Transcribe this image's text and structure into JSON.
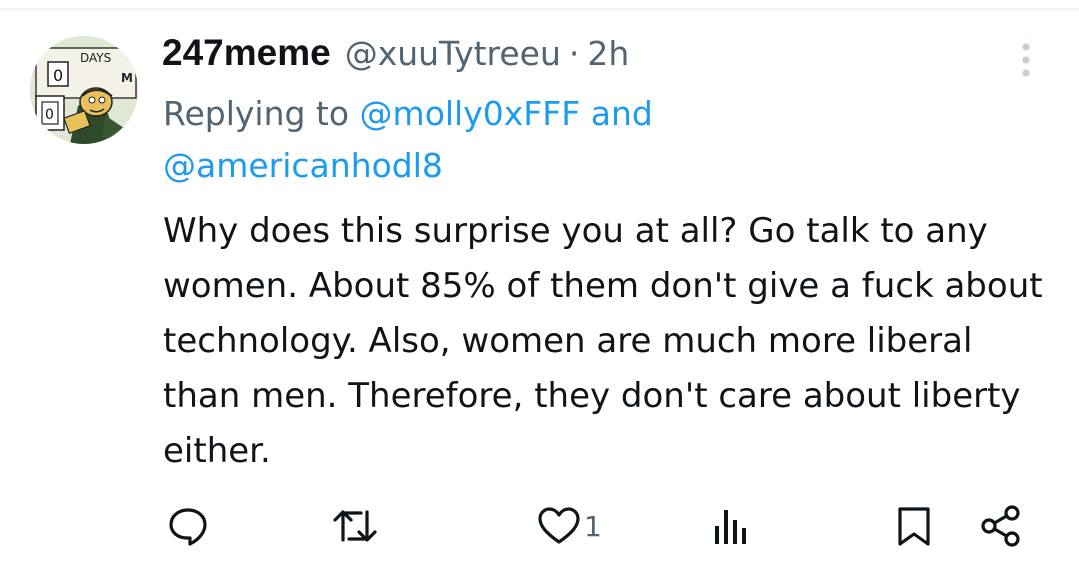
{
  "tweet": {
    "display_name": "247meme",
    "handle": "@xuuTytreeu",
    "separator": "·",
    "time": "2h",
    "replying_prefix": "Replying to",
    "replying_mention_1": "@molly0xFFF",
    "replying_joiner": "and",
    "replying_mention_2": "@americanhodl8",
    "text": "Why does this surprise you at all? Go talk to any women. About 85% of them don't give a fuck about technology. Also, women are much more liberal than men. Therefore, they don't care about liberty either.",
    "avatar_text": {
      "sign_top": "DAYS",
      "sign_left": "0",
      "sign_bottom": "0",
      "sign_right": "M"
    }
  },
  "actions": {
    "reply_icon": "reply-bubble-icon",
    "retweet_icon": "retweet-icon",
    "like_icon": "heart-icon",
    "like_count": "1",
    "views_icon": "analytics-icon",
    "bookmark_icon": "bookmark-icon",
    "share_icon": "share-icon"
  },
  "colors": {
    "text": "#0f1419",
    "secondary": "#536471",
    "link": "#1d9bf0",
    "divider": "#eff3f4"
  }
}
